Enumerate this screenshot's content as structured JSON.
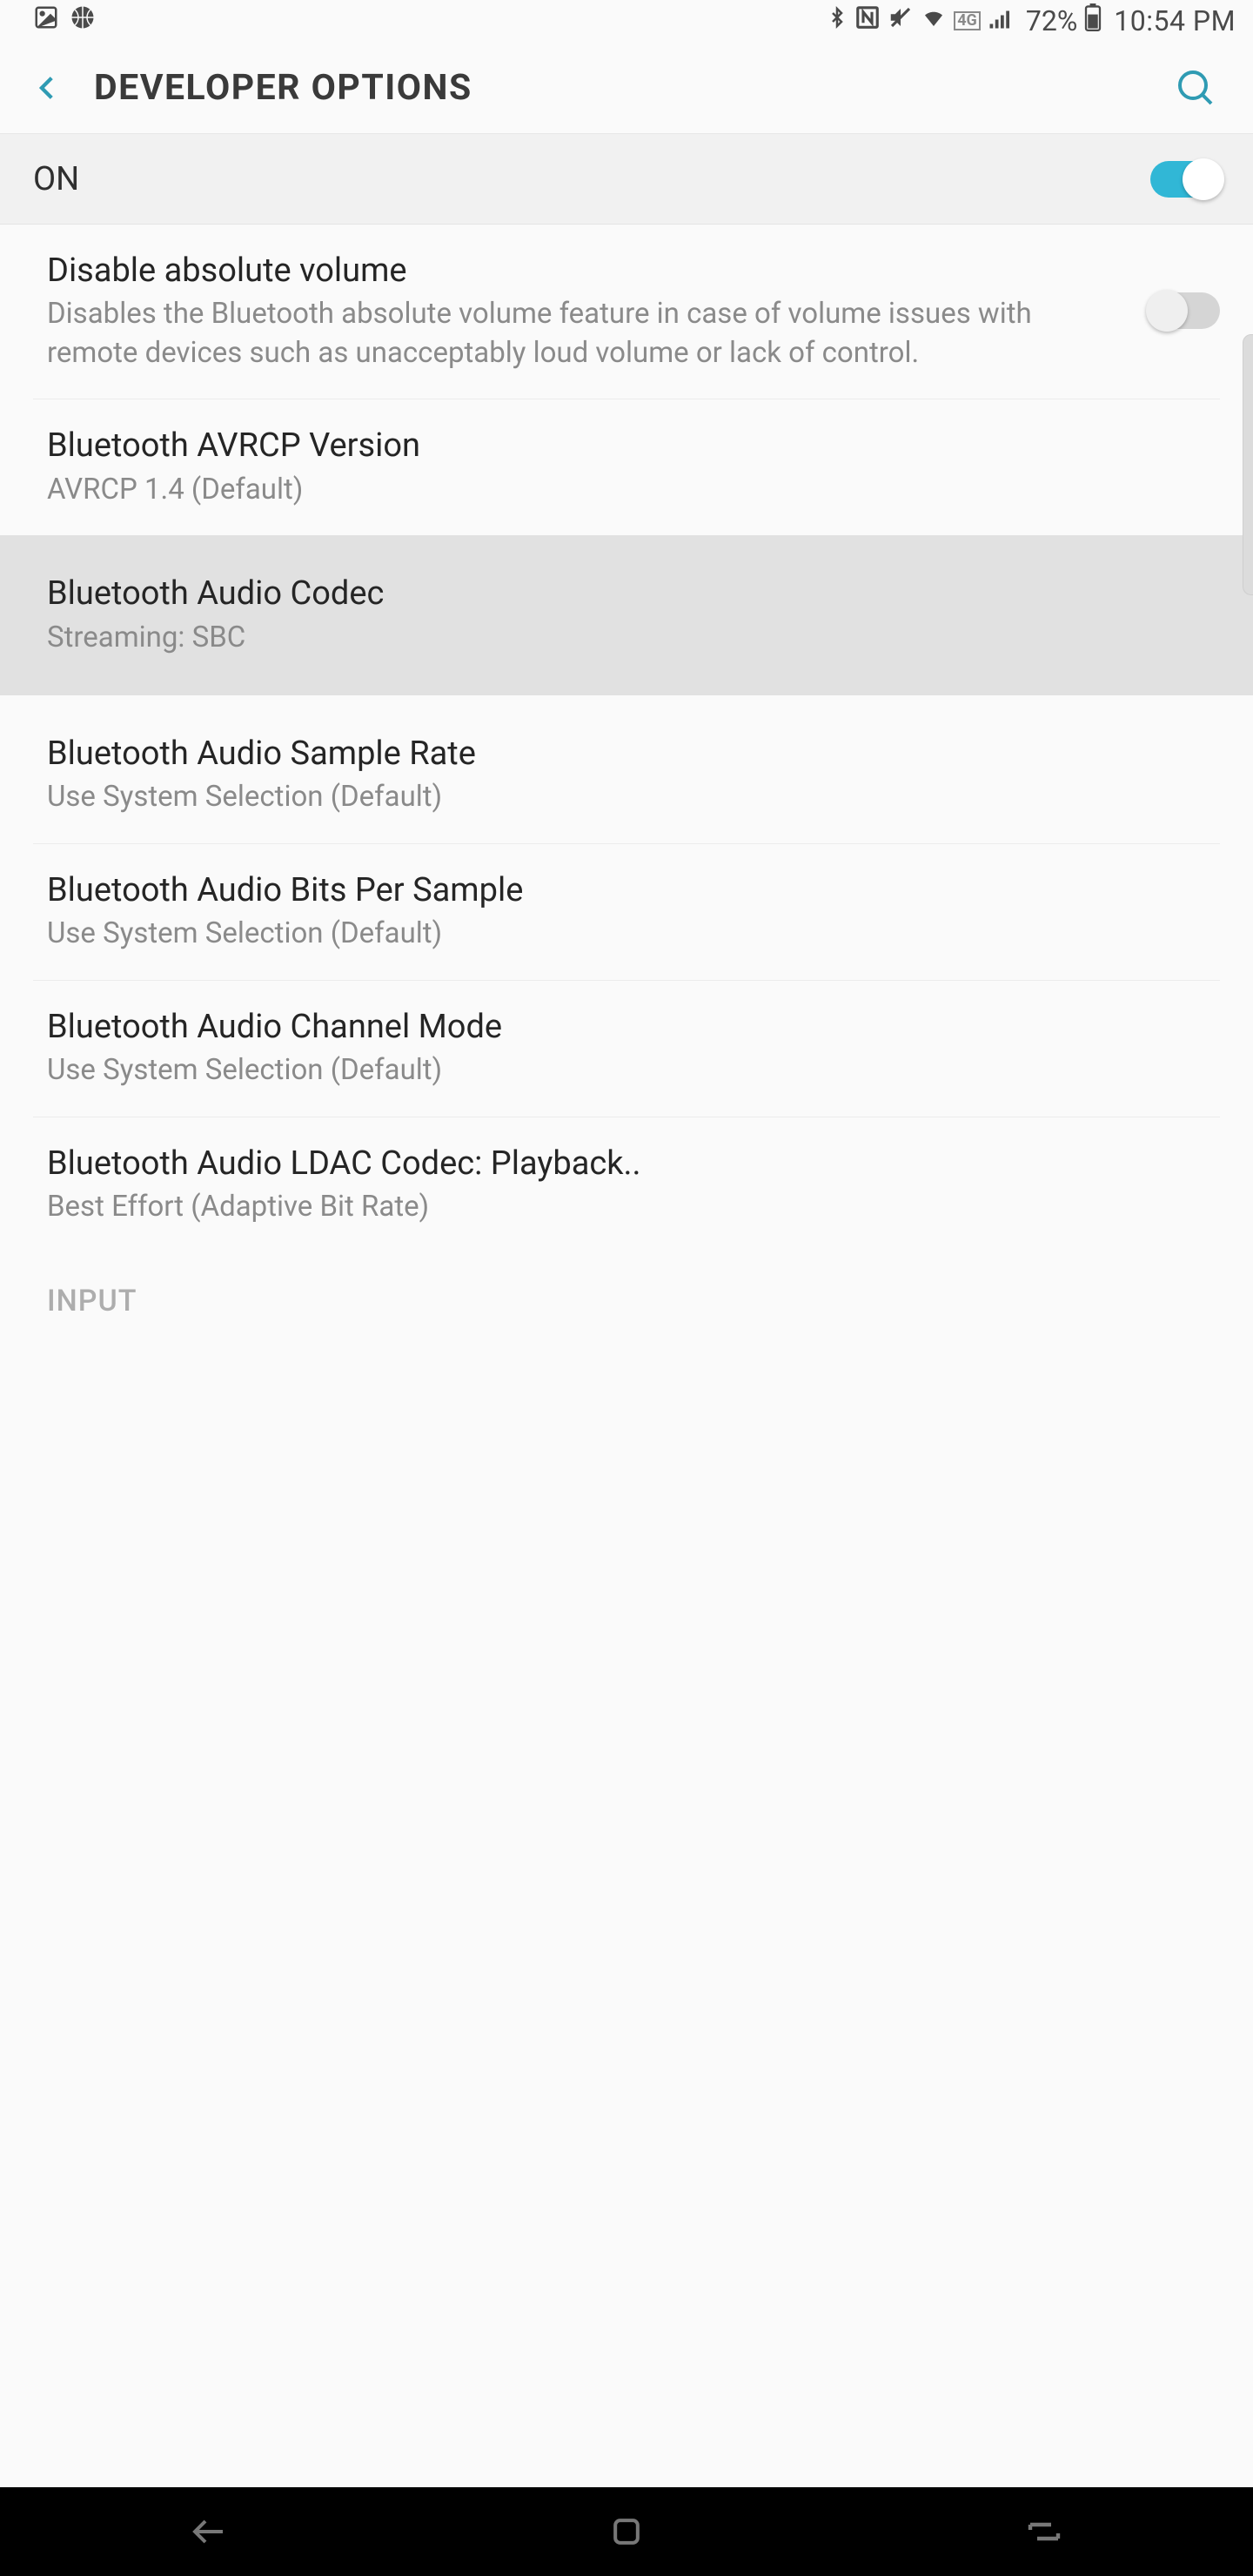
{
  "status": {
    "battery_pct": "72%",
    "time": "10:54 PM",
    "network_indicator": "4G"
  },
  "header": {
    "title": "DEVELOPER OPTIONS"
  },
  "master": {
    "label": "ON",
    "enabled": true
  },
  "items": [
    {
      "title": "Disable absolute volume",
      "subtitle": "Disables the Bluetooth absolute volume feature in case of volume issues with remote devices such as unacceptably loud volume or lack of control.",
      "has_switch": true,
      "switch_on": false
    },
    {
      "title": "Bluetooth AVRCP Version",
      "subtitle": "AVRCP 1.4 (Default)"
    },
    {
      "title": "Bluetooth Audio Codec",
      "subtitle": "Streaming: SBC",
      "highlighted": true
    },
    {
      "title": "Bluetooth Audio Sample Rate",
      "subtitle": "Use System Selection (Default)"
    },
    {
      "title": "Bluetooth Audio Bits Per Sample",
      "subtitle": "Use System Selection (Default)"
    },
    {
      "title": "Bluetooth Audio Channel Mode",
      "subtitle": "Use System Selection (Default)"
    },
    {
      "title": "Bluetooth Audio LDAC Codec: Playback..",
      "subtitle": "Best Effort (Adaptive Bit Rate)"
    }
  ],
  "next_section": "INPUT"
}
